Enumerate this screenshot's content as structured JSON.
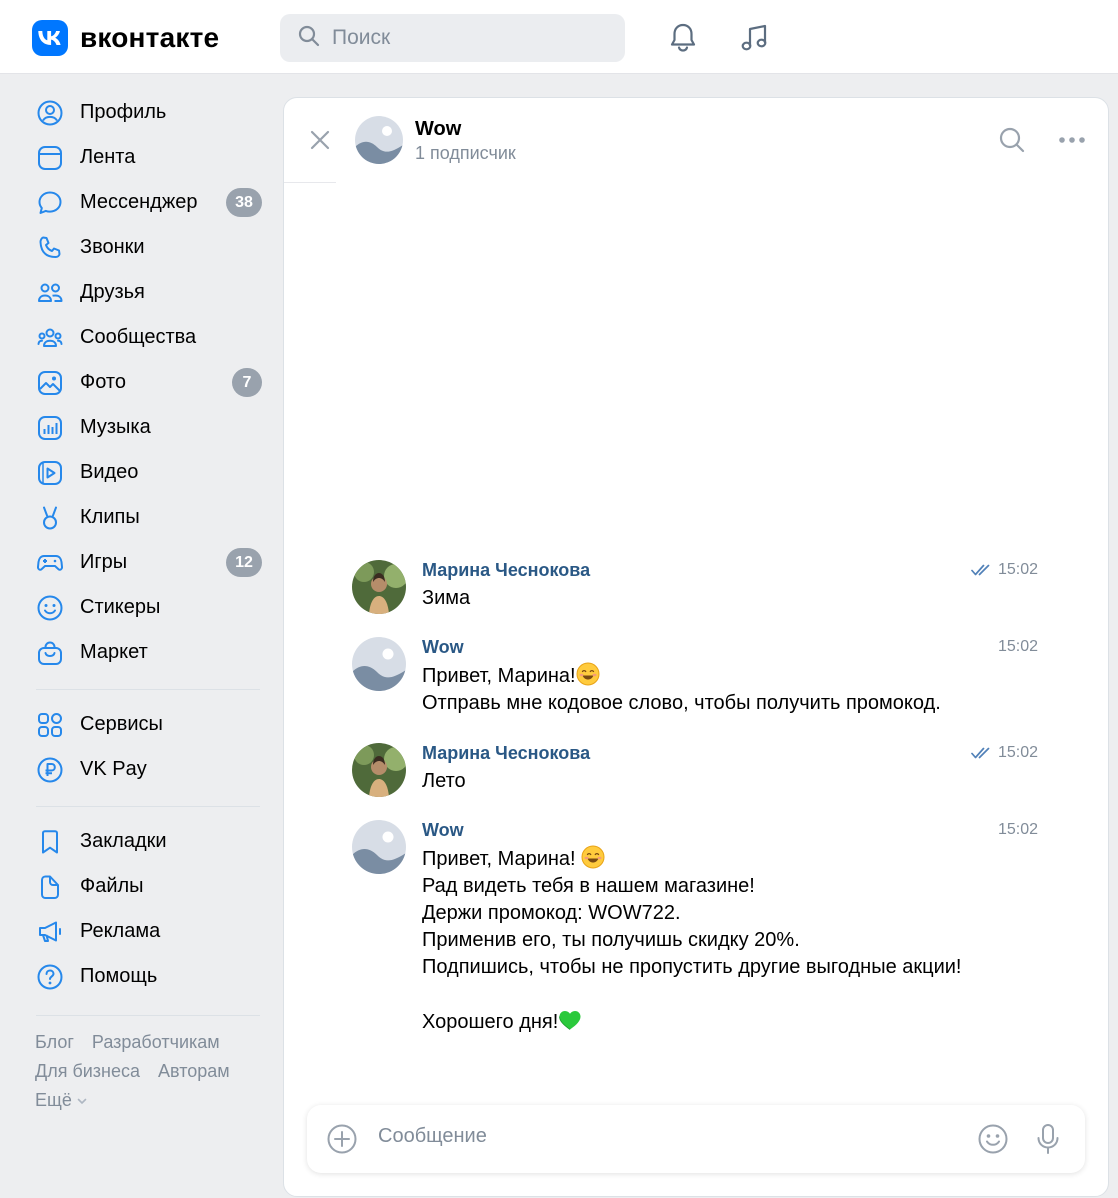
{
  "brand": {
    "logo_text": "вконтакте",
    "accent": "#0077ff"
  },
  "header": {
    "search_placeholder": "Поиск",
    "icons": [
      "bell-icon",
      "music-icon"
    ]
  },
  "sidebar": {
    "items": [
      {
        "label": "Профиль",
        "icon": "user-circle-icon"
      },
      {
        "label": "Лента",
        "icon": "news-icon"
      },
      {
        "label": "Мессенджер",
        "icon": "message-icon",
        "badge": "38"
      },
      {
        "label": "Звонки",
        "icon": "phone-icon"
      },
      {
        "label": "Друзья",
        "icon": "friends-icon"
      },
      {
        "label": "Сообщества",
        "icon": "communities-icon"
      },
      {
        "label": "Фото",
        "icon": "photo-icon",
        "badge": "7"
      },
      {
        "label": "Музыка",
        "icon": "music-icon"
      },
      {
        "label": "Видео",
        "icon": "video-icon"
      },
      {
        "label": "Клипы",
        "icon": "clips-icon"
      },
      {
        "label": "Игры",
        "icon": "gamepad-icon",
        "badge": "12"
      },
      {
        "label": "Стикеры",
        "icon": "smile-icon"
      },
      {
        "label": "Маркет",
        "icon": "bag-icon"
      }
    ],
    "items2": [
      {
        "label": "Сервисы",
        "icon": "services-icon"
      },
      {
        "label": "VK Pay",
        "icon": "ruble-icon"
      }
    ],
    "items3": [
      {
        "label": "Закладки",
        "icon": "bookmark-icon"
      },
      {
        "label": "Файлы",
        "icon": "file-icon"
      },
      {
        "label": "Реклама",
        "icon": "megaphone-icon"
      },
      {
        "label": "Помощь",
        "icon": "help-icon"
      }
    ],
    "footer": {
      "blog": "Блог",
      "developers": "Разработчикам",
      "business": "Для бизнеса",
      "authors": "Авторам",
      "more": "Ещё"
    }
  },
  "chat": {
    "title": "Wow",
    "subtitle": "1 подписчик",
    "messages": [
      {
        "author": "Марина Чеснокова",
        "time": "15:02",
        "read": true,
        "text": "Зима"
      },
      {
        "author": "Wow",
        "time": "15:02",
        "read": false,
        "text": "Привет, Марина!",
        "text_after_emoji": "\nОтправь мне кодовое слово, чтобы получить промокод."
      },
      {
        "author": "Марина Чеснокова",
        "time": "15:02",
        "read": true,
        "text": "Лето"
      },
      {
        "author": "Wow",
        "time": "15:02",
        "read": false,
        "line1": "Привет, Марина! ",
        "rest": "Рад видеть тебя в нашем магазине!\nДержи промокод: WOW722.\nПрименив его, ты получишь скидку 20%.\nПодпишись, чтобы не пропустить другие выгодные акции!\n\nХорошего дня!"
      }
    ],
    "composer_placeholder": "Сообщение"
  }
}
